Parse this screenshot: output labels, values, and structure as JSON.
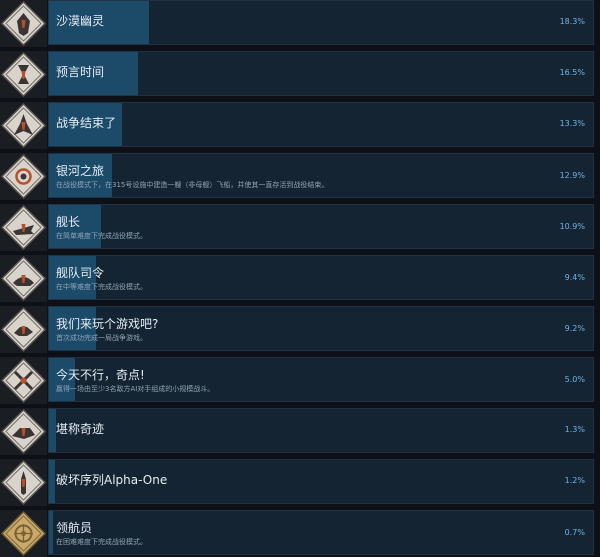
{
  "achievements": [
    {
      "title": "沙漠幽灵",
      "description": "",
      "percent": "18.3%",
      "fill": 0.19
    },
    {
      "title": "预言时间",
      "description": "",
      "percent": "16.5%",
      "fill": 0.17
    },
    {
      "title": "战争结束了",
      "description": "",
      "percent": "13.3%",
      "fill": 0.14
    },
    {
      "title": "银河之旅",
      "description": "在战役模式下，在315号设施中建造一艘（非母舰）飞船，并使其一直存活到战役结束。",
      "percent": "12.9%",
      "fill": 0.12
    },
    {
      "title": "舰长",
      "description": "在简单难度下完成战役模式。",
      "percent": "10.9%",
      "fill": 0.1
    },
    {
      "title": "舰队司令",
      "description": "在中等难度下完成战役模式。",
      "percent": "9.4%",
      "fill": 0.09
    },
    {
      "title": "我们来玩个游戏吧?",
      "description": "首次成功完成一局战争游戏。",
      "percent": "9.2%",
      "fill": 0.09
    },
    {
      "title": "今天不行，奇点!",
      "description": "赢得一场由至少3名敌方AI对手组成的小规模战斗。",
      "percent": "5.0%",
      "fill": 0.05
    },
    {
      "title": "堪称奇迹",
      "description": "",
      "percent": "1.3%",
      "fill": 0.013
    },
    {
      "title": "破坏序列Alpha-One",
      "description": "",
      "percent": "1.2%",
      "fill": 0.012
    },
    {
      "title": "领航员",
      "description": "在困难难度下完成战役模式。",
      "percent": "0.7%",
      "fill": 0.007
    }
  ],
  "colors": {
    "panel": "#152432",
    "bar": "#1c4a69",
    "percent_text": "#6fb3e6",
    "title_text": "#e6edf3",
    "desc_text": "#8ea4b6",
    "badge_gold": "#c9a86a"
  },
  "icons": [
    "ghost-emblem-icon",
    "hourglass-emblem-icon",
    "fleet-emblem-icon",
    "ring-emblem-icon",
    "ship-emblem-icon",
    "ship-emblem-icon",
    "handshake-emblem-icon",
    "crossed-swords-emblem-icon",
    "ship-emblem-icon",
    "sequence-emblem-icon",
    "wheel-emblem-icon"
  ]
}
